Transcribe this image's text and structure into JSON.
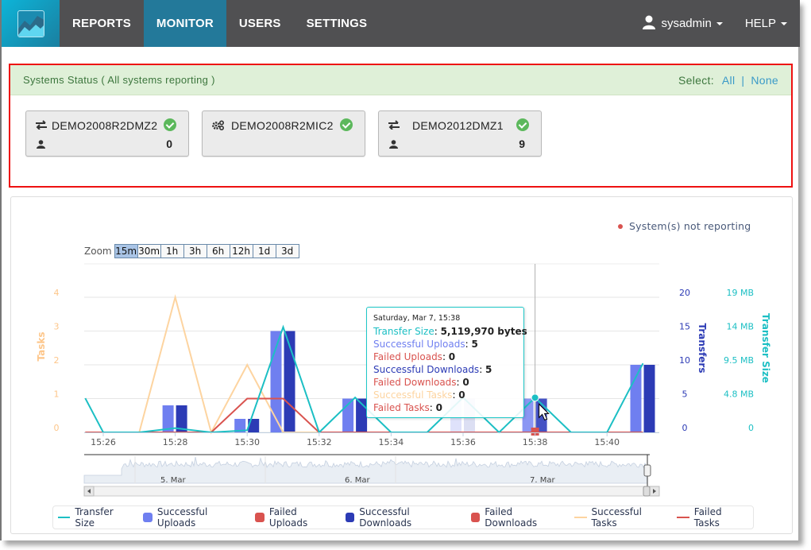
{
  "navbar": {
    "items": [
      {
        "label": "REPORTS",
        "active": false
      },
      {
        "label": "MONITOR",
        "active": true
      },
      {
        "label": "USERS",
        "active": false
      },
      {
        "label": "SETTINGS",
        "active": false
      }
    ],
    "user": "sysadmin",
    "help": "HELP"
  },
  "status": {
    "title": "Systems Status ( All systems reporting )",
    "select_label": "Select:",
    "select_all": "All",
    "select_none": "None",
    "systems": [
      {
        "name": "DEMO2008R2DMZ2",
        "icon": "transfer-arrows-icon",
        "status": "ok",
        "users": "0"
      },
      {
        "name": "DEMO2008R2MIC2",
        "icon": "gears-icon",
        "status": "ok",
        "users": null
      },
      {
        "name": "DEMO2012DMZ1",
        "icon": "transfer-arrows-icon",
        "status": "ok",
        "users": "9"
      }
    ]
  },
  "chart_panel": {
    "not_reporting": "System(s) not reporting",
    "zoom_label": "Zoom",
    "zoom_options": [
      "15m",
      "30m",
      "1h",
      "3h",
      "6h",
      "12h",
      "1d",
      "3d"
    ],
    "zoom_selected": "15m",
    "navigator_labels": [
      "5. Mar",
      "6. Mar",
      "7. Mar"
    ]
  },
  "tooltip": {
    "date": "Saturday, Mar 7, 15:38",
    "rows": [
      {
        "label": "Transfer Size",
        "value": "5,119,970 bytes",
        "color": "#1cbfc4"
      },
      {
        "label": "Successful Uploads",
        "value": "5",
        "color": "#6f7ff0"
      },
      {
        "label": "Failed Uploads",
        "value": "0",
        "color": "#d9534f"
      },
      {
        "label": "Successful Downloads",
        "value": "5",
        "color": "#2c3bb5"
      },
      {
        "label": "Failed Downloads",
        "value": "0",
        "color": "#d9534f"
      },
      {
        "label": "Successful Tasks",
        "value": "0",
        "color": "#fdd4a0"
      },
      {
        "label": "Failed Tasks",
        "value": "0",
        "color": "#d9534f"
      }
    ]
  },
  "chart_data": {
    "type": "bar",
    "title": "",
    "x": [
      "15:25.5",
      "15:26",
      "15:27",
      "15:28",
      "15:29",
      "15:30",
      "15:31",
      "15:32",
      "15:33",
      "15:34",
      "15:35",
      "15:36",
      "15:37",
      "15:38",
      "15:39",
      "15:40",
      "15:41"
    ],
    "x_ticks": [
      "15:26",
      "15:28",
      "15:30",
      "15:32",
      "15:34",
      "15:36",
      "15:38",
      "15:40"
    ],
    "left_axis": {
      "label": "Tasks",
      "ticks": [
        "0",
        "1",
        "2",
        "3",
        "4"
      ],
      "range": [
        0,
        4
      ],
      "color": "#fdc68a"
    },
    "right_axis_transfers": {
      "label": "Transfers",
      "ticks": [
        "0",
        "5",
        "10",
        "15",
        "20"
      ],
      "range": [
        0,
        20
      ],
      "color": "#2c3bb5"
    },
    "right_axis_size": {
      "label": "Transfer Size",
      "ticks": [
        "0",
        "4.8 MB",
        "9.5 MB",
        "14 MB",
        "19 MB"
      ],
      "range_mb": [
        0,
        19
      ],
      "color": "#1cbfc4"
    },
    "bars": [
      {
        "time": "15:28",
        "uploads": 4,
        "downloads": 4
      },
      {
        "time": "15:30",
        "uploads": 2,
        "downloads": 2
      },
      {
        "time": "15:31",
        "uploads": 15,
        "downloads": 15
      },
      {
        "time": "15:33",
        "uploads": 5,
        "downloads": 5
      },
      {
        "time": "15:36",
        "uploads": 5,
        "downloads": 5
      },
      {
        "time": "15:38",
        "uploads": 5,
        "downloads": 5
      },
      {
        "time": "15:41",
        "uploads": 10,
        "downloads": 10
      }
    ],
    "series": [
      {
        "name": "Transfer Size",
        "type": "line",
        "unit": "MB",
        "points": [
          [
            "15:25.5",
            4.8
          ],
          [
            "15:26",
            0
          ],
          [
            "15:27",
            0
          ],
          [
            "15:28",
            0.6
          ],
          [
            "15:29",
            0
          ],
          [
            "15:30",
            0.3
          ],
          [
            "15:31",
            14.8
          ],
          [
            "15:32",
            0
          ],
          [
            "15:33",
            4.9
          ],
          [
            "15:34",
            0
          ],
          [
            "15:35",
            0
          ],
          [
            "15:36",
            4.9
          ],
          [
            "15:37",
            0
          ],
          [
            "15:38",
            4.88
          ],
          [
            "15:39",
            0
          ],
          [
            "15:40",
            0
          ],
          [
            "15:41",
            9.7
          ]
        ]
      },
      {
        "name": "Successful Uploads",
        "type": "bar"
      },
      {
        "name": "Failed Uploads",
        "type": "bar"
      },
      {
        "name": "Successful Downloads",
        "type": "bar"
      },
      {
        "name": "Failed Downloads",
        "type": "bar"
      },
      {
        "name": "Successful Tasks",
        "type": "line",
        "points": [
          [
            "15:25.5",
            0
          ],
          [
            "15:27",
            0
          ],
          [
            "15:28",
            4
          ],
          [
            "15:29",
            0
          ],
          [
            "15:30",
            2
          ],
          [
            "15:31",
            0
          ],
          [
            "15:32",
            0
          ]
        ]
      },
      {
        "name": "Failed Tasks",
        "type": "line",
        "points": [
          [
            "15:25.5",
            0
          ],
          [
            "15:29",
            0
          ],
          [
            "15:30",
            1
          ],
          [
            "15:31",
            1
          ],
          [
            "15:32",
            0
          ],
          [
            "15:41",
            0
          ]
        ]
      }
    ],
    "highlight": {
      "time": "15:38",
      "failed_downloads_marker": 0
    },
    "legend_position": "bottom",
    "grid": true
  },
  "legend": [
    {
      "label": "Transfer Size",
      "kind": "line",
      "color": "#1cbfc4"
    },
    {
      "label": "Successful Uploads",
      "kind": "box",
      "color": "#6f7ff0"
    },
    {
      "label": "Failed Uploads",
      "kind": "box",
      "color": "#d9534f"
    },
    {
      "label": "Successful Downloads",
      "kind": "box",
      "color": "#2c3bb5"
    },
    {
      "label": "Failed Downloads",
      "kind": "box",
      "color": "#d9534f"
    },
    {
      "label": "Successful Tasks",
      "kind": "line",
      "color": "#fdd4a0"
    },
    {
      "label": "Failed Tasks",
      "kind": "line",
      "color": "#d9534f"
    }
  ]
}
